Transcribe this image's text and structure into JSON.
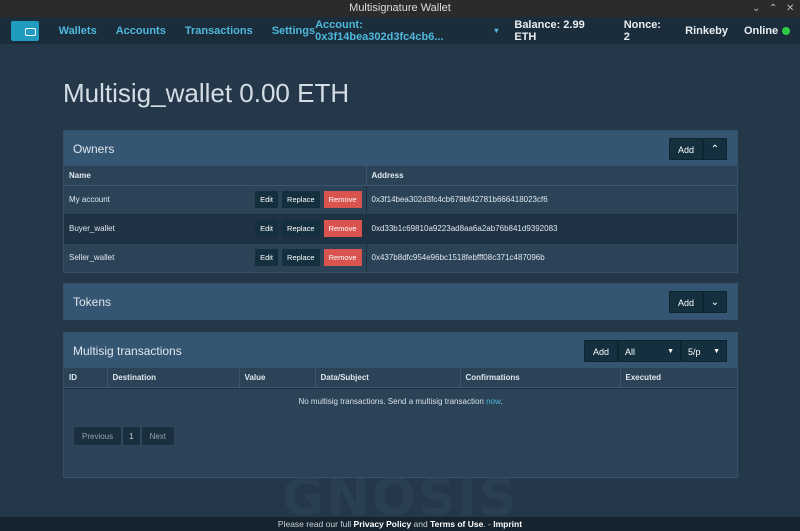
{
  "window": {
    "title": "Multisignature Wallet"
  },
  "nav": {
    "links": [
      "Wallets",
      "Accounts",
      "Transactions",
      "Settings"
    ],
    "account": "Account: 0x3f14bea302d3fc4cb6...",
    "balance": "Balance: 2.99 ETH",
    "nonce": "Nonce: 2",
    "network": "Rinkeby",
    "status": "Online",
    "status_color": "#2ecc40"
  },
  "page": {
    "title": "Multisig_wallet 0.00 ETH"
  },
  "owners": {
    "title": "Owners",
    "add_label": "Add",
    "chevron": "chevron-up-icon",
    "columns": [
      "Name",
      "Address"
    ],
    "edit_label": "Edit",
    "replace_label": "Replace",
    "remove_label": "Remove",
    "rows": [
      {
        "name": "My account",
        "address": "0x3f14bea302d3fc4cb678bf42781b666418023cf6"
      },
      {
        "name": "Buyer_wallet",
        "address": "0xd33b1c69810a9223ad8aa6a2ab76b841d9392083"
      },
      {
        "name": "Seller_wallet",
        "address": "0x437b8dfc954e96bc1518febfff08c371c487096b"
      }
    ]
  },
  "tokens": {
    "title": "Tokens",
    "add_label": "Add",
    "chevron": "chevron-down-icon"
  },
  "multisig": {
    "title": "Multisig transactions",
    "add_label": "Add",
    "filter_value": "All",
    "per_page_value": "5/p",
    "columns": [
      "ID",
      "Destination",
      "Value",
      "Data/Subject",
      "Confirmations",
      "Executed"
    ],
    "empty_text": "No multisig transactions. Send a multisig transaction ",
    "empty_link": "now",
    "empty_suffix": ".",
    "pager": {
      "prev": "Previous",
      "page": "1",
      "next": "Next"
    }
  },
  "watermark": "GNOSIS",
  "footer": {
    "prefix": "Please read our full ",
    "privacy": "Privacy Policy",
    "and": " and ",
    "terms": "Terms of Use",
    "sep": ". - ",
    "imprint": "Imprint"
  }
}
